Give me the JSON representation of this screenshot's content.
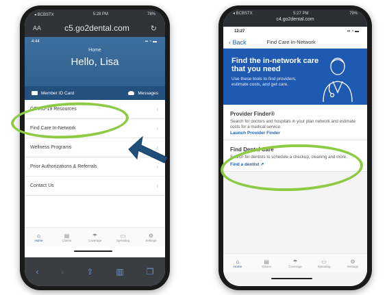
{
  "left_phone": {
    "status": {
      "carrier": "◂ BCBSTX",
      "time": "5:28 PM",
      "battery": "78%"
    },
    "url_bar": {
      "aa": "AA",
      "address": "c5.go2dental.com"
    },
    "app_status": {
      "time": "4:44"
    },
    "header": {
      "home": "Home",
      "greeting": "Hello, Lisa",
      "member_id": "Member ID Card",
      "messages": "Messages"
    },
    "menu": [
      {
        "label": "COVID-19 Resources"
      },
      {
        "label": "Find Care In-Network"
      },
      {
        "label": "Wellness Programs"
      },
      {
        "label": "Prior Authorizations & Referrals"
      },
      {
        "label": "Contact Us"
      }
    ],
    "tabs": [
      {
        "label": "Home",
        "icon": "home-icon"
      },
      {
        "label": "Claims",
        "icon": "claims-icon"
      },
      {
        "label": "Coverage",
        "icon": "coverage-icon"
      },
      {
        "label": "Spending",
        "icon": "spending-icon"
      },
      {
        "label": "Settings",
        "icon": "settings-icon"
      }
    ]
  },
  "right_phone": {
    "status": {
      "carrier": "◂ BCBSTX",
      "time": "5:27 PM",
      "battery": "79%"
    },
    "url": "c4.go2dental.com",
    "app_status": {
      "time": "12:27"
    },
    "nav": {
      "back": "Back",
      "title": "Find Care In-Network"
    },
    "hero": {
      "heading": "Find the in-network care that you need",
      "subtext": "Use these tools to find providers, estimate costs, and get care."
    },
    "cards": [
      {
        "title": "Provider Finder®",
        "desc": "Search for doctors and hospitals in your plan network and estimate costs for a medical service.",
        "link": "Launch Provider Finder"
      },
      {
        "title": "Find Dental Care",
        "desc": "Search for dentists to schedule a checkup, cleaning and more.",
        "link": "Find a dentist ↗"
      }
    ],
    "tabs": [
      {
        "label": "Home",
        "icon": "home-icon"
      },
      {
        "label": "Claims",
        "icon": "claims-icon"
      },
      {
        "label": "Coverage",
        "icon": "coverage-icon"
      },
      {
        "label": "Spending",
        "icon": "spending-icon"
      },
      {
        "label": "Settings",
        "icon": "settings-icon"
      }
    ]
  },
  "colors": {
    "highlight_ring": "#8ccb43",
    "arrow": "#1f4e79",
    "brand_blue": "#1f5ab2"
  }
}
